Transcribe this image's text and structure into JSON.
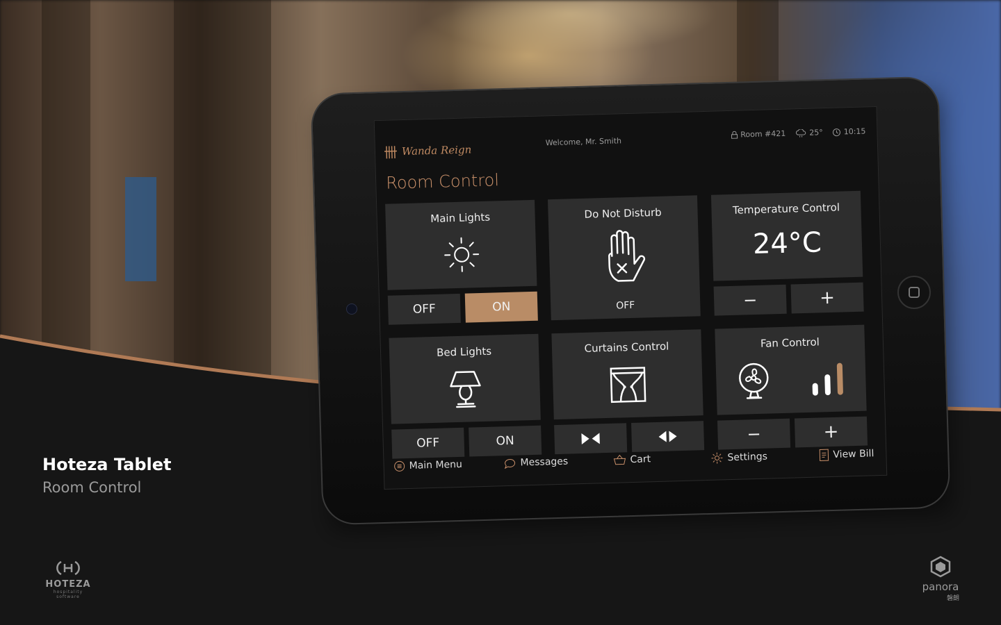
{
  "colors": {
    "accent": "#b98c66",
    "title_accent": "#c9906a",
    "tile_bg": "#2e2e2e",
    "screen_bg": "#111111",
    "page_bg": "#141414"
  },
  "caption": {
    "title": "Hoteza Tablet",
    "subtitle": "Room Control"
  },
  "brands": {
    "left": {
      "icon": "hoteza-logo-icon",
      "name": "HOTEZA",
      "tagline": "hospitality software"
    },
    "right": {
      "icon": "panora-logo-icon",
      "name": "panora",
      "cn": "磐朗"
    }
  },
  "screen": {
    "logo": {
      "mark": "卌",
      "name": "Wanda Reign"
    },
    "welcome": "Welcome, Mr. Smith",
    "status": {
      "room": "Room #421",
      "weather": "25°",
      "time": "10:15",
      "room_icon": "lock-icon",
      "weather_icon": "cloud-rain-icon",
      "time_icon": "clock-icon"
    },
    "title": "Room Control",
    "tiles": {
      "main_lights": {
        "title": "Main Lights",
        "icon": "sun-icon",
        "off": "OFF",
        "on": "ON",
        "state": "ON"
      },
      "do_not_disturb": {
        "title": "Do Not Disturb",
        "icon": "hand-stop-icon",
        "state": "OFF"
      },
      "temperature": {
        "title": "Temperature Control",
        "value": "24°C",
        "minus": "−",
        "plus": "+"
      },
      "bed_lights": {
        "title": "Bed Lights",
        "icon": "lamp-icon",
        "off": "OFF",
        "on": "ON",
        "state": "OFF"
      },
      "curtains": {
        "title": "Curtains Control",
        "icon": "curtains-icon",
        "close_icon": "curtain-close-icon",
        "open_icon": "curtain-open-icon"
      },
      "fan": {
        "title": "Fan Control",
        "icon": "fan-icon",
        "level_icon": "signal-bars-icon",
        "level": 3,
        "max_level": 3,
        "minus": "−",
        "plus": "+"
      }
    },
    "nav": [
      {
        "label": "Main Menu",
        "icon": "menu-icon"
      },
      {
        "label": "Messages",
        "icon": "chat-icon"
      },
      {
        "label": "Cart",
        "icon": "basket-icon"
      },
      {
        "label": "Settings",
        "icon": "gear-icon"
      },
      {
        "label": "View Bill",
        "icon": "receipt-icon"
      }
    ]
  }
}
